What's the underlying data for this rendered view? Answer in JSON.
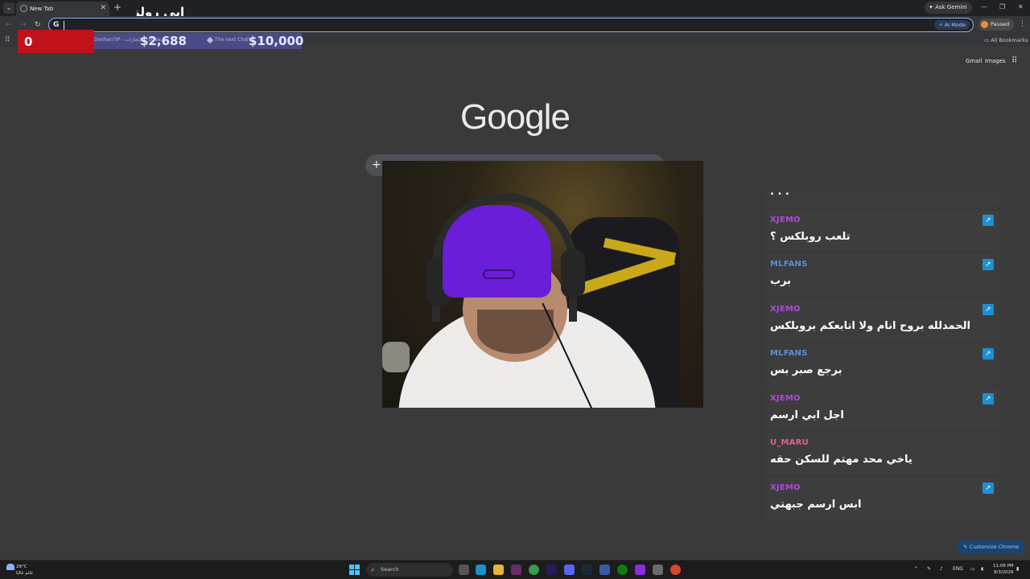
{
  "browser": {
    "tab_title": "New Tab",
    "new_tab": "+",
    "ask_gemini": "Ask Gemini",
    "ai_mode": "AI Mode",
    "profile_label": "Paused",
    "all_bookmarks": "All Bookmarks"
  },
  "stream_overlay": {
    "title": "ابي رولز",
    "counter": "0",
    "goal1_label": "DonhanTIP - الإنجازات / Strea...",
    "goal1_amount": "$2,688",
    "goal2_label": "The next Chall...",
    "goal2_amount": "$10,000"
  },
  "ntp": {
    "gmail": "Gmail",
    "images": "Images",
    "logo": "Google",
    "customize": "Customize Chrome"
  },
  "chat": {
    "messages": [
      {
        "user": "XJEMO",
        "text": "تلعب روبلكس ؟",
        "color": "#b04bd8",
        "badge": true
      },
      {
        "user": "MLFANS",
        "text": "برب",
        "color": "#5b8fd8",
        "badge": true
      },
      {
        "user": "XJEMO",
        "text": "الحمدلله بروح انام ولا اتابعكم بروبلكس",
        "color": "#b04bd8",
        "badge": true
      },
      {
        "user": "MLFANS",
        "text": "برجع صبر بس",
        "color": "#5b8fd8",
        "badge": true
      },
      {
        "user": "XJEMO",
        "text": "اجل ابي ارسم",
        "color": "#b04bd8",
        "badge": true
      },
      {
        "user": "U_MARU",
        "text": "ياخي محد مهتم للسكن حقه",
        "color": "#e0609a",
        "badge": false
      },
      {
        "user": "XJEMO",
        "text": "ابس ارسم جبهتي",
        "color": "#b04bd8",
        "badge": true
      }
    ]
  },
  "taskbar": {
    "temperature": "26°C",
    "weather_desc": "غائم غالبًا",
    "search_placeholder": "Search",
    "language": "ENG",
    "time": "11:08 PM",
    "date": "8/3/2026"
  }
}
